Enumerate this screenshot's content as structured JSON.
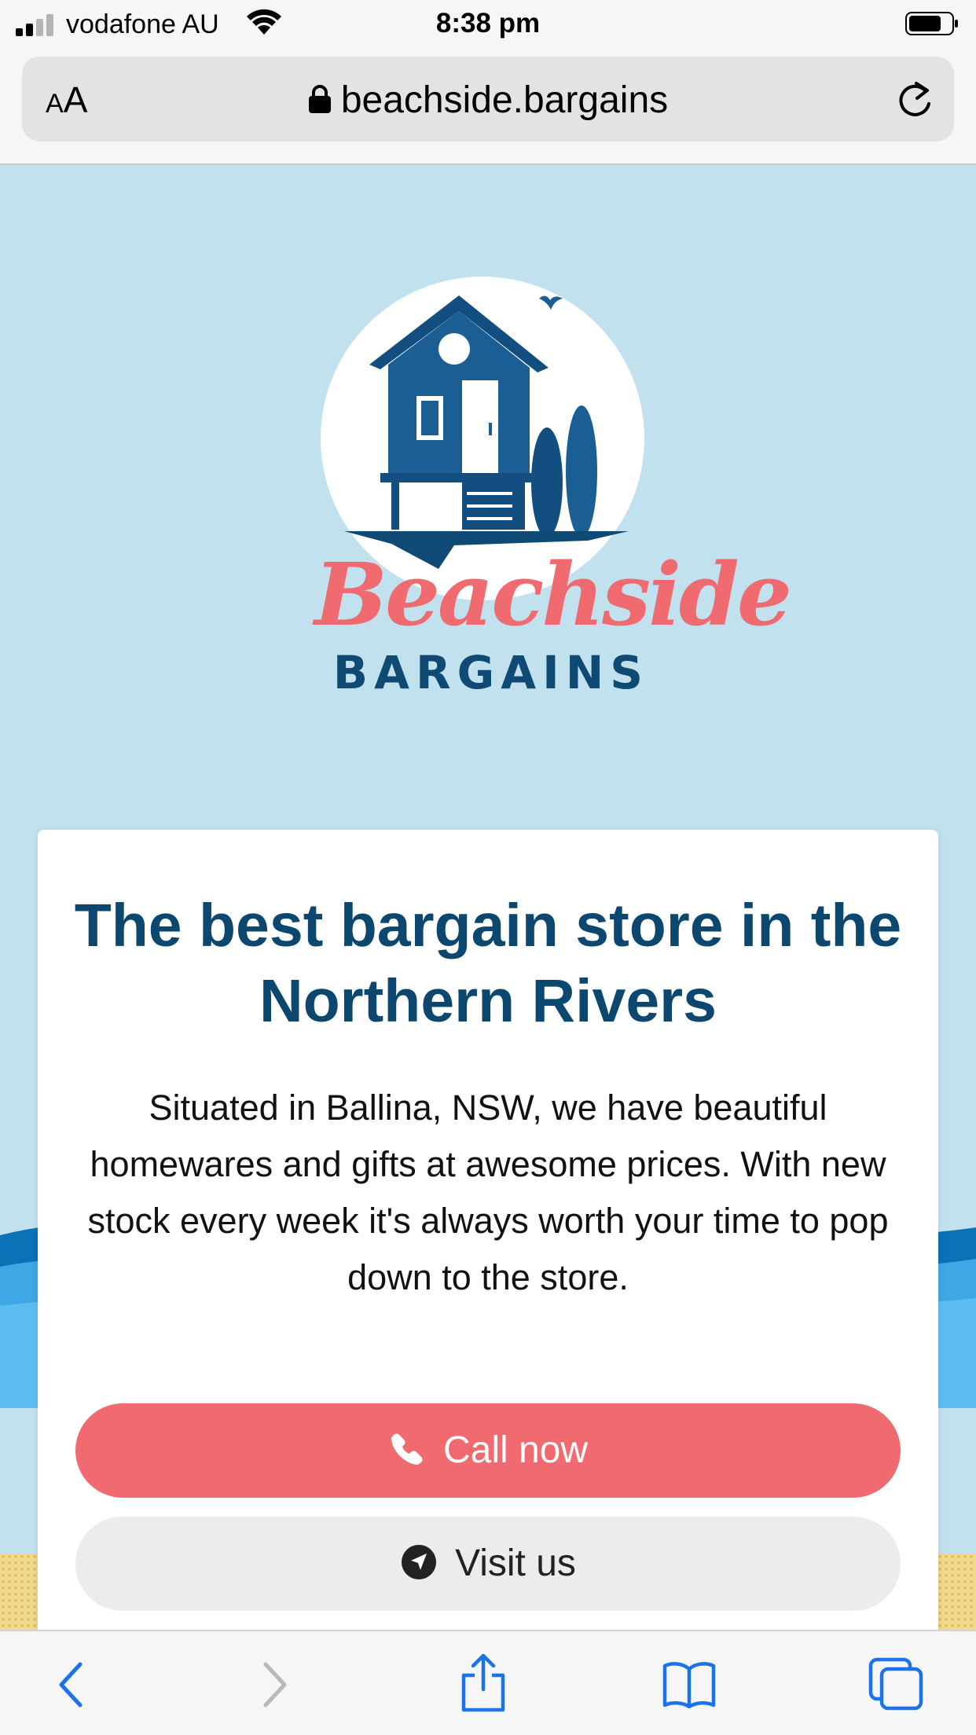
{
  "status_bar": {
    "carrier": "vodafone AU",
    "time": "8:38 pm",
    "signal_bars_filled": 2,
    "signal_bars_total": 4,
    "battery_level": 0.75
  },
  "browser": {
    "text_size_label_small": "A",
    "text_size_label_large": "A",
    "url": "beachside.bargains"
  },
  "logo": {
    "script": "Beachside",
    "subtitle": "BARGAINS"
  },
  "hero": {
    "headline": "The best bargain store in the Northern Rivers",
    "description": "Situated in Ballina, NSW, we have beautiful homewares and gifts at awesome prices. With new stock every week it's always worth your time to pop down to the store."
  },
  "actions": {
    "call_label": "Call now",
    "visit_label": "Visit us"
  },
  "toolbar": {
    "icons": [
      "back-icon",
      "forward-icon",
      "share-icon",
      "bookmarks-icon",
      "tabs-icon"
    ]
  },
  "colors": {
    "accent": "#ef6b70",
    "brand_navy": "#0c4770",
    "sky": "#c1e1ef",
    "ios_blue": "#1a73e8"
  }
}
